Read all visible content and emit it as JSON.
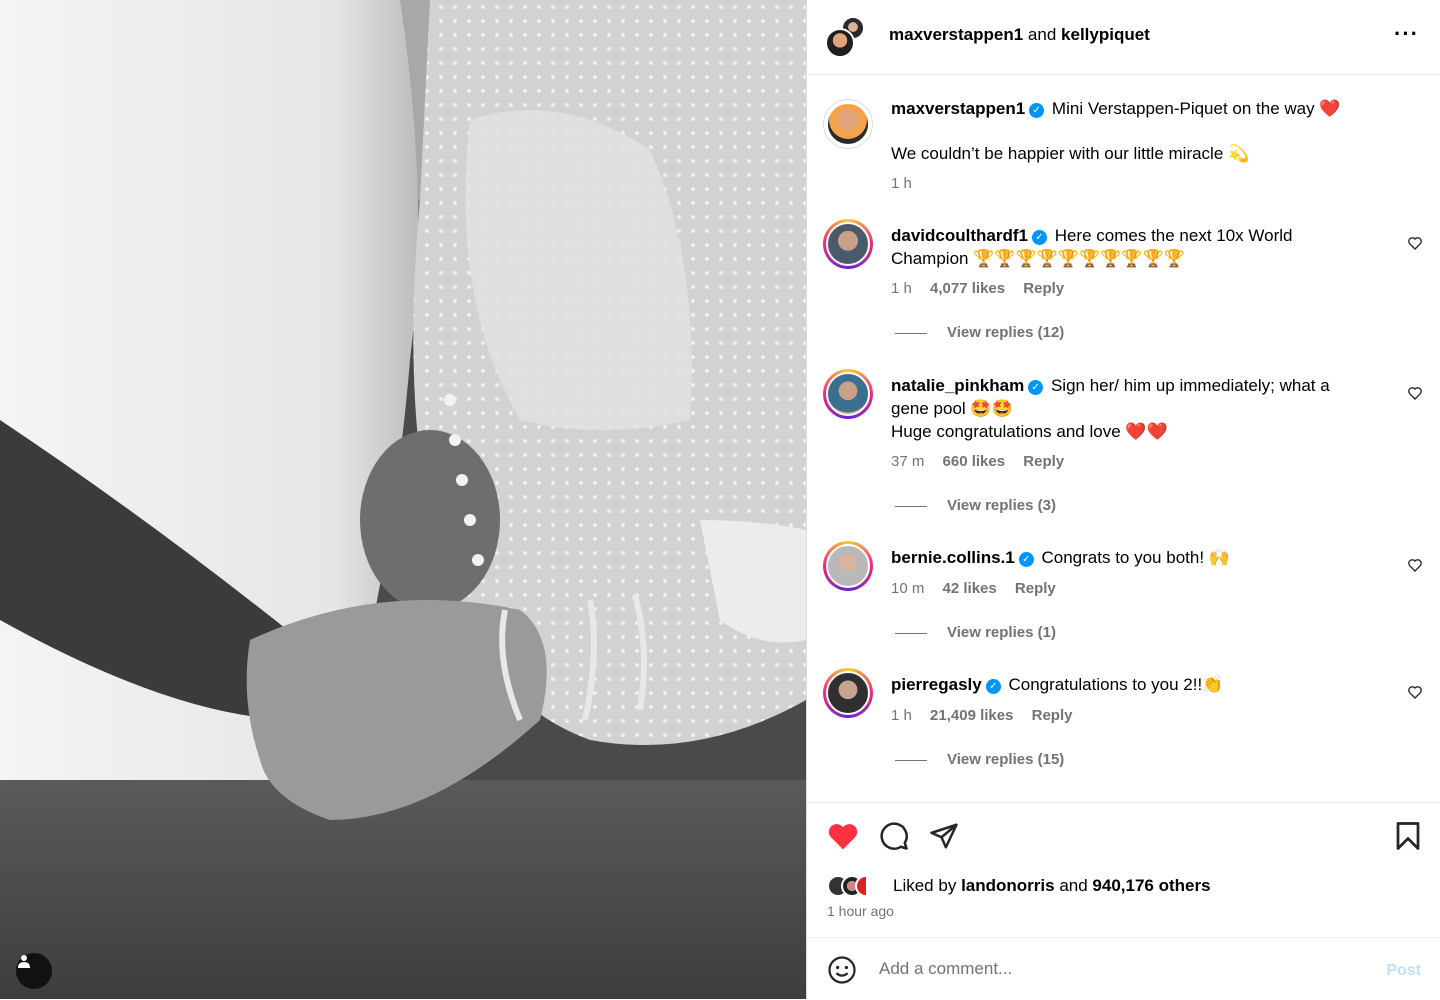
{
  "header": {
    "user1": "maxverstappen1",
    "joiner": "and",
    "user2": "kellypiquet",
    "more_icon": "more-icon"
  },
  "caption": {
    "username": "maxverstappen1",
    "line1": "Mini Verstappen-Piquet on the way ❤️",
    "line2": "We couldn’t be happier with our little miracle 💫",
    "time": "1 h"
  },
  "comments": [
    {
      "username": "davidcoulthardf1",
      "text": "Here comes the next 10x World Champion 🏆🏆🏆🏆🏆🏆🏆🏆🏆🏆",
      "time": "1 h",
      "likes": "4,077 likes",
      "reply": "Reply",
      "view_replies": "View replies (12)"
    },
    {
      "username": "natalie_pinkham",
      "text": "Sign her/ him up immediately; what a gene pool 🤩🤩",
      "text2": "Huge congratulations and love ❤️❤️",
      "time": "37 m",
      "likes": "660 likes",
      "reply": "Reply",
      "view_replies": "View replies (3)"
    },
    {
      "username": "bernie.collins.1",
      "text": "Congrats to you both! 🙌",
      "time": "10 m",
      "likes": "42 likes",
      "reply": "Reply",
      "view_replies": "View replies (1)"
    },
    {
      "username": "pierregasly",
      "text": "Congratulations to you 2!!👏",
      "time": "1 h",
      "likes": "21,409 likes",
      "reply": "Reply",
      "view_replies": "View replies (15)"
    }
  ],
  "likes": {
    "prefix": "Liked by",
    "user": "landonorris",
    "joiner": "and",
    "others": "940,176 others",
    "time_ago": "1 hour ago"
  },
  "comment_box": {
    "placeholder": "Add a comment...",
    "post_label": "Post"
  },
  "colors": {
    "like_red": "#ff3040",
    "verified_blue": "#0095f6",
    "muted": "#737373"
  }
}
